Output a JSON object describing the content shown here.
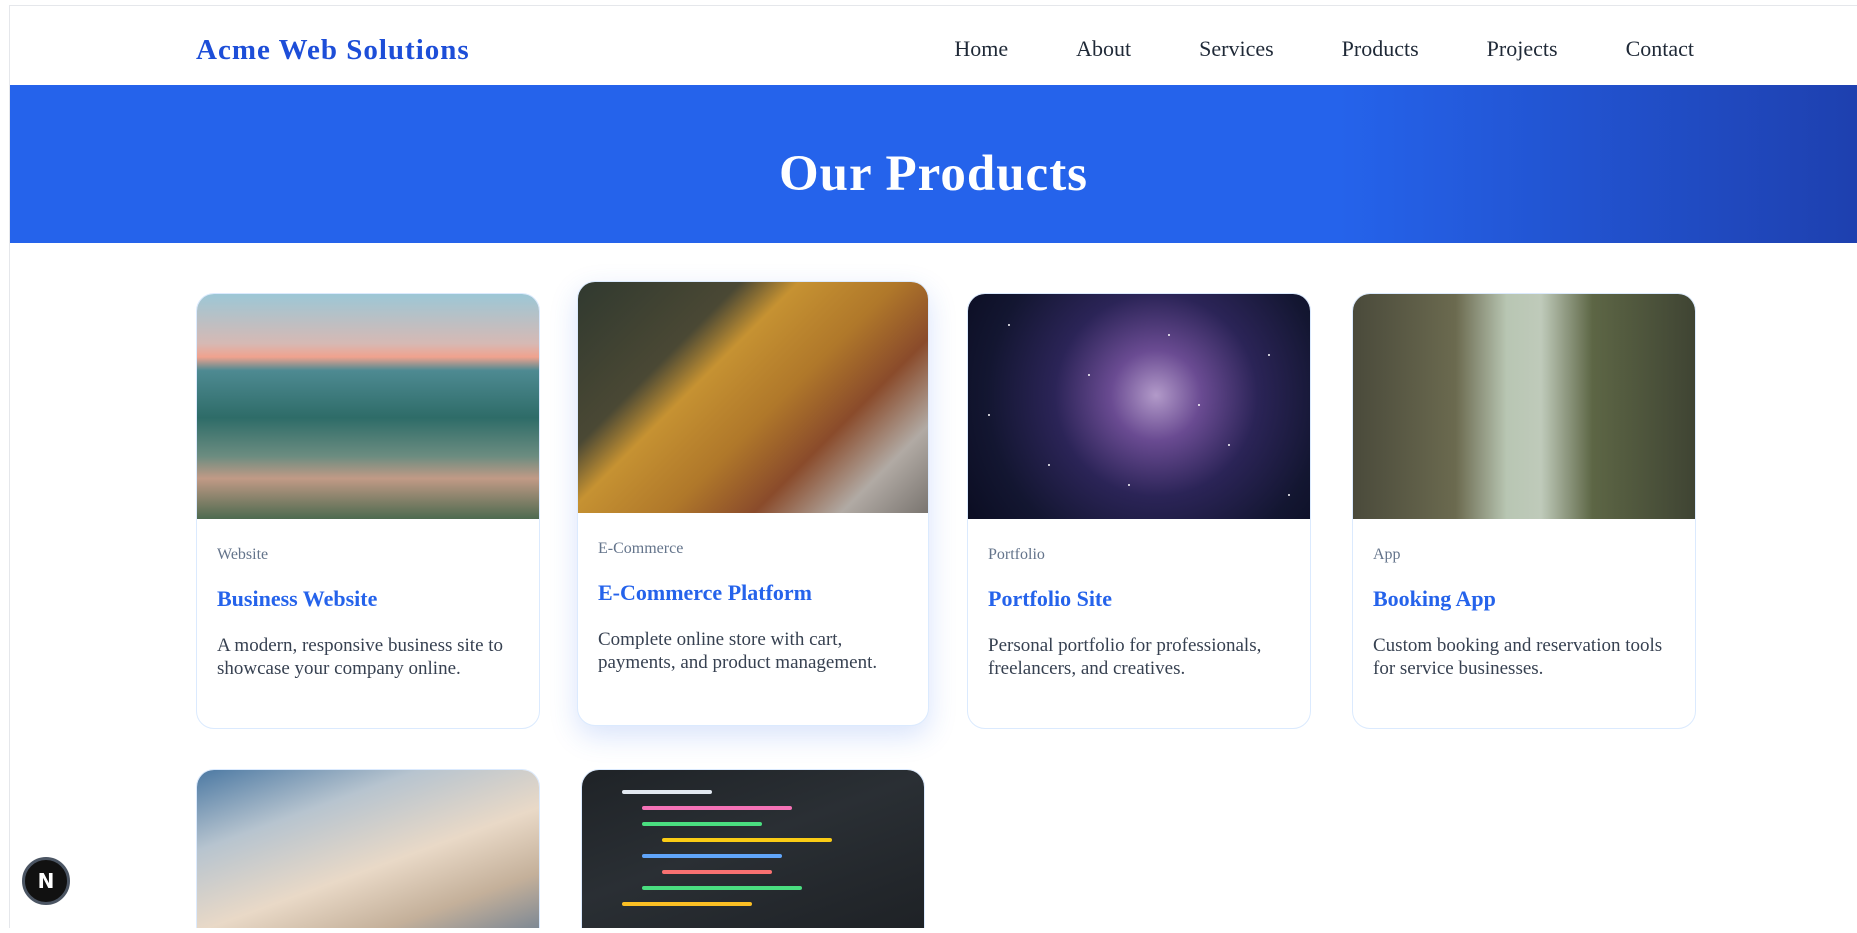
{
  "brand": "Acme Web Solutions",
  "nav": [
    "Home",
    "About",
    "Services",
    "Products",
    "Projects",
    "Contact"
  ],
  "hero_title": "Our Products",
  "products": [
    {
      "category": "Website",
      "title": "Business Website",
      "description": "A modern, responsive business site to showcase your company online.",
      "image": "mountain-lake-photo"
    },
    {
      "category": "E-Commerce",
      "title": "E-Commerce Platform",
      "description": "Complete online store with cart, payments, and product management.",
      "image": "person-typing-on-laptop-photo"
    },
    {
      "category": "Portfolio",
      "title": "Portfolio Site",
      "description": "Personal portfolio for professionals, freelancers, and creatives.",
      "image": "milky-way-night-sky-photo"
    },
    {
      "category": "App",
      "title": "Booking App",
      "description": "Custom booking and reservation tools for service businesses.",
      "image": "forest-road-photo"
    },
    {
      "image": "team-working-at-table-photo"
    },
    {
      "image": "code-on-screen-photo"
    }
  ],
  "badge_letter": "N",
  "colors": {
    "accent": "#2563eb",
    "hero_end": "#1e40af",
    "text": "#1f2937",
    "muted": "#64748b"
  }
}
